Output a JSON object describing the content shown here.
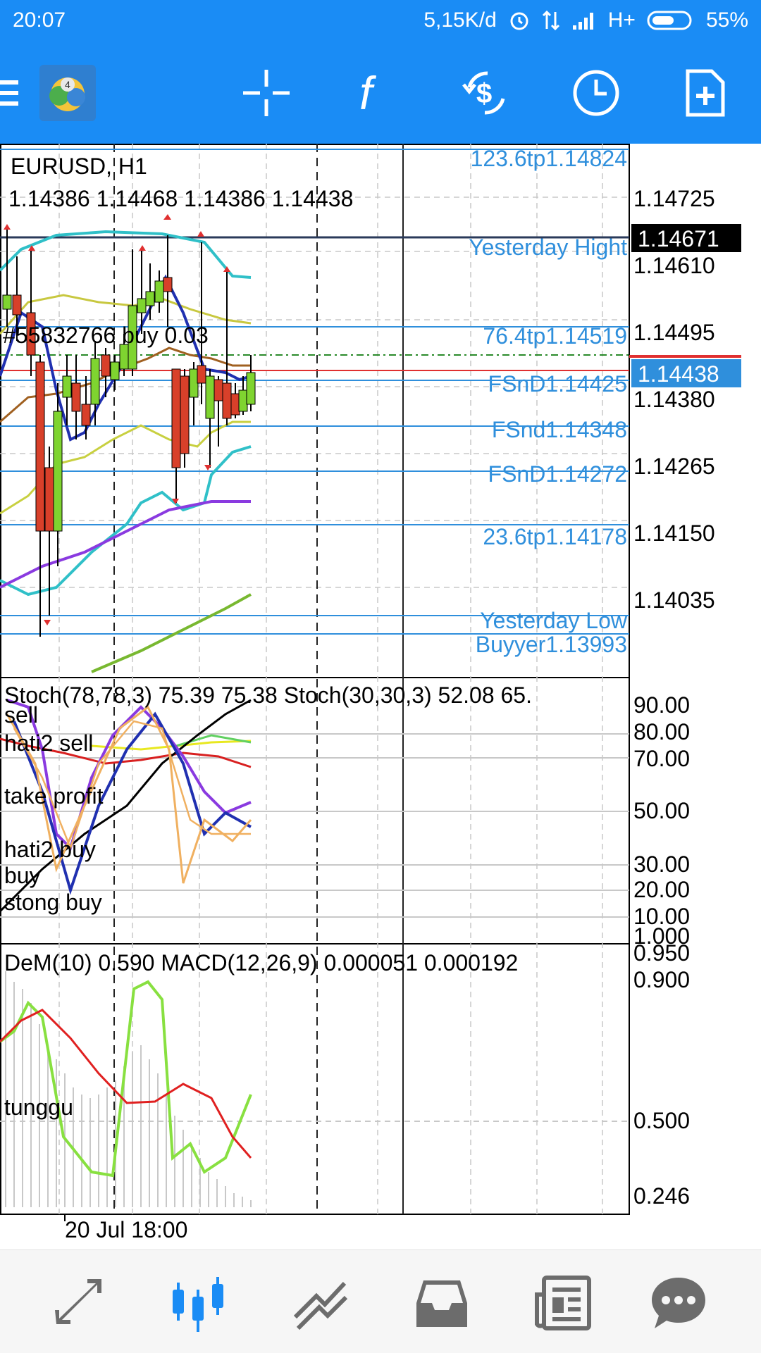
{
  "status_bar": {
    "time": "20:07",
    "speed": "5,15K/d",
    "network": "H+",
    "battery": "55%",
    "icons": [
      "alarm-icon",
      "data-transfer-icon",
      "signal-icon",
      "battery-icon"
    ]
  },
  "toolbar": {
    "buttons": [
      "menu-icon",
      "metatrader-logo",
      "crosshair-icon",
      "indicators-icon",
      "trade-icon",
      "timeframe-icon",
      "new-order-icon"
    ]
  },
  "main_chart": {
    "symbol": "EURUSD, H1",
    "ohlc": "1.14386 1.14468 1.14386 1.14438",
    "order_label": "#55832766 buy 0.03",
    "price_axis": [
      "1.14725",
      "1.14610",
      "1.14495",
      "1.14380",
      "1.14265",
      "1.14150",
      "1.14035"
    ],
    "highlight_black": "1.14671",
    "highlight_blue": "1.14438",
    "levels": [
      "123.6tp1.14824",
      "Yesterday Hight",
      "76.4tp1.14519",
      "FSnD1.14425",
      "FSnd1.14348",
      "FSnD1.14272",
      "23.6tp1.14178",
      "Yesterday Low",
      "Buyyer1.13993"
    ]
  },
  "stoch_panel": {
    "header": "Stoch(78,78,3) 75.39 75.38 Stoch(30,30,3) 52.08 65.",
    "labels": [
      "sell",
      "hati2 sell",
      "take profit",
      "hati2 buy",
      "buy",
      "stong buy"
    ],
    "axis": [
      "90.00",
      "80.00",
      "70.00",
      "50.00",
      "30.00",
      "20.00",
      "10.00",
      "1.000"
    ]
  },
  "dem_panel": {
    "header": "DeM(10) 0.590 MACD(12,26,9) 0.000051 0.000192",
    "label": "tunggu",
    "axis": [
      "0.950",
      "0.900",
      "0.500",
      "0.246"
    ]
  },
  "time_axis": {
    "label": "20 Jul 18:00"
  },
  "bottom_nav": {
    "items": [
      "quotes-icon",
      "chart-icon",
      "trade-history-icon",
      "inbox-icon",
      "news-icon",
      "chat-icon"
    ],
    "active": "chart-icon"
  },
  "colors": {
    "primary": "#1a8cf5",
    "level_line": "#2f8fdc",
    "bid_line": "#e03030",
    "up_candle": "#7fd430",
    "down_candle": "#d8402a"
  }
}
